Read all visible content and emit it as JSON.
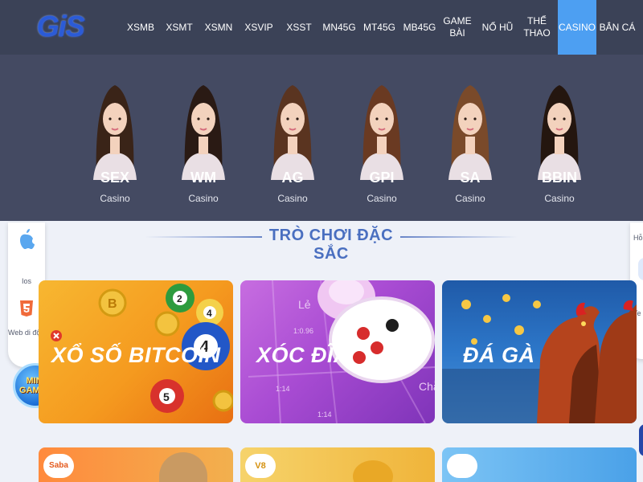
{
  "header": {
    "logo_text": "GiS",
    "nav": [
      {
        "label": "XSMB",
        "name": "nav-xsmb"
      },
      {
        "label": "XSMT",
        "name": "nav-xsmt"
      },
      {
        "label": "XSMN",
        "name": "nav-xsmn"
      },
      {
        "label": "XSVIP",
        "name": "nav-xsvip"
      },
      {
        "label": "XSST",
        "name": "nav-xsst"
      },
      {
        "label": "MN45G",
        "name": "nav-mn45g"
      },
      {
        "label": "MT45G",
        "name": "nav-mt45g"
      },
      {
        "label": "MB45G",
        "name": "nav-mb45g"
      },
      {
        "label": "GAME\nBÀI",
        "name": "nav-game-bai"
      },
      {
        "label": "NỔ HŨ",
        "name": "nav-no-hu"
      },
      {
        "label": "THỂ\nTHAO",
        "name": "nav-the-thao"
      },
      {
        "label": "CASINO",
        "name": "nav-casino"
      },
      {
        "label": "BẮN CÁ",
        "name": "nav-ban-ca"
      }
    ],
    "active_nav": "CASINO"
  },
  "casino_menu": {
    "providers": [
      {
        "name": "SEX",
        "sub": "Casino"
      },
      {
        "name": "WM",
        "sub": "Casino"
      },
      {
        "name": "AG",
        "sub": "Casino"
      },
      {
        "name": "GPI",
        "sub": "Casino"
      },
      {
        "name": "SA",
        "sub": "Casino"
      },
      {
        "name": "BBIN",
        "sub": "Casino"
      }
    ]
  },
  "featured": {
    "title": "TRÒ CHƠI ĐẶC SẮC",
    "games": [
      {
        "title": "XỔ SỐ BITCOIN",
        "name": "game-xo-so-bitcoin"
      },
      {
        "title": "XÓC ĐĨA",
        "name": "game-xoc-dia"
      },
      {
        "title": "ĐÁ GÀ",
        "name": "game-da-ga"
      }
    ],
    "xoc_dia_board_labels": [
      "Lẻ",
      "1:0.96",
      "1:14",
      "1:14",
      "Chẵ"
    ],
    "row2_labels": [
      "Saba",
      "V8"
    ]
  },
  "left_sidebar": {
    "ios_label": "Ios",
    "web_label": "Web di động",
    "mini_games": [
      "MINI",
      "GAMES"
    ]
  },
  "right_sidebar": {
    "top_label": "Hỗ",
    "bottom_label": "Te"
  },
  "colors": {
    "nav_bg": "#3b4257",
    "nav_active": "#4d9ff2",
    "panel_bg": "#444a62",
    "section_title": "#4a6fc0",
    "page_bg": "#eef1f8"
  }
}
